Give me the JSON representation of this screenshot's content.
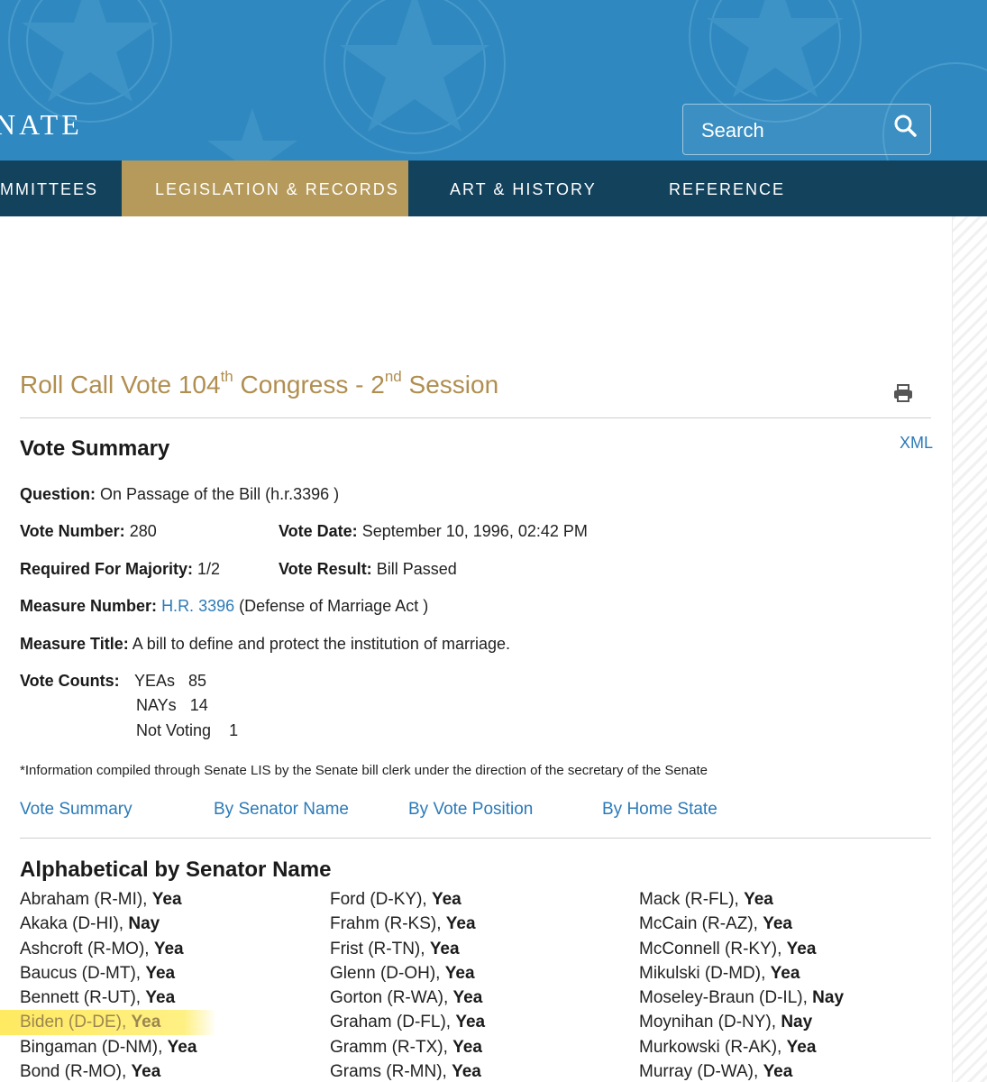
{
  "header": {
    "brand": "NATE",
    "search_placeholder": "Search",
    "nav": [
      {
        "label": "MMITTEES",
        "active": false
      },
      {
        "label": "LEGISLATION & RECORDS",
        "active": true
      },
      {
        "label": "ART & HISTORY",
        "active": false
      },
      {
        "label": "REFERENCE",
        "active": false
      }
    ]
  },
  "title": {
    "part1": "Roll Call Vote 104",
    "sup1": "th",
    "part2": " Congress - 2",
    "sup2": "nd",
    "part3": " Session"
  },
  "summary": {
    "heading": "Vote Summary",
    "xml": "XML",
    "question_label": "Question:",
    "question_value": "On Passage of the Bill (h.r.3396 )",
    "vote_number_label": "Vote Number:",
    "vote_number_value": "280",
    "vote_date_label": "Vote Date:",
    "vote_date_value": "September 10, 1996, 02:42 PM",
    "majority_label": "Required For Majority:",
    "majority_value": "1/2",
    "result_label": "Vote Result:",
    "result_value": "Bill Passed",
    "measure_number_label": "Measure Number:",
    "measure_number_link": "H.R. 3396",
    "measure_number_suffix": "(Defense of Marriage Act )",
    "measure_title_label": "Measure Title:",
    "measure_title_value": "A bill to define and protect the institution of marriage.",
    "counts_label": "Vote Counts:",
    "yeas_label": "YEAs",
    "yeas_value": "85",
    "nays_label": "NAYs",
    "nays_value": "14",
    "not_voting_label": "Not Voting",
    "not_voting_value": "1",
    "note": "*Information compiled through Senate LIS by the Senate bill clerk under the direction of the secretary of the Senate"
  },
  "tabs": [
    "Vote Summary",
    "By Senator Name",
    "By Vote Position",
    "By Home State"
  ],
  "senators_heading": "Alphabetical by Senator Name",
  "senators": {
    "col1": [
      {
        "name": "Abraham (R-MI), ",
        "pos": "Yea"
      },
      {
        "name": "Akaka (D-HI), ",
        "pos": "Nay"
      },
      {
        "name": "Ashcroft (R-MO), ",
        "pos": "Yea"
      },
      {
        "name": "Baucus (D-MT), ",
        "pos": "Yea"
      },
      {
        "name": "Bennett (R-UT), ",
        "pos": "Yea"
      },
      {
        "name": "Biden (D-DE), ",
        "pos": "Yea",
        "highlighted": true
      },
      {
        "name": "Bingaman (D-NM), ",
        "pos": "Yea"
      },
      {
        "name": "Bond (R-MO), ",
        "pos": "Yea"
      }
    ],
    "col2": [
      {
        "name": "Ford (D-KY), ",
        "pos": "Yea"
      },
      {
        "name": "Frahm (R-KS), ",
        "pos": "Yea"
      },
      {
        "name": "Frist (R-TN), ",
        "pos": "Yea"
      },
      {
        "name": "Glenn (D-OH), ",
        "pos": "Yea"
      },
      {
        "name": "Gorton (R-WA), ",
        "pos": "Yea"
      },
      {
        "name": "Graham (D-FL), ",
        "pos": "Yea"
      },
      {
        "name": "Gramm (R-TX), ",
        "pos": "Yea"
      },
      {
        "name": "Grams (R-MN), ",
        "pos": "Yea"
      }
    ],
    "col3": [
      {
        "name": "Mack (R-FL), ",
        "pos": "Yea"
      },
      {
        "name": "McCain (R-AZ), ",
        "pos": "Yea"
      },
      {
        "name": "McConnell (R-KY), ",
        "pos": "Yea"
      },
      {
        "name": "Mikulski (D-MD), ",
        "pos": "Yea"
      },
      {
        "name": "Moseley-Braun (D-IL), ",
        "pos": "Nay"
      },
      {
        "name": "Moynihan (D-NY), ",
        "pos": "Nay"
      },
      {
        "name": "Murkowski (R-AK), ",
        "pos": "Yea"
      },
      {
        "name": "Murray (D-WA), ",
        "pos": "Yea"
      }
    ]
  }
}
